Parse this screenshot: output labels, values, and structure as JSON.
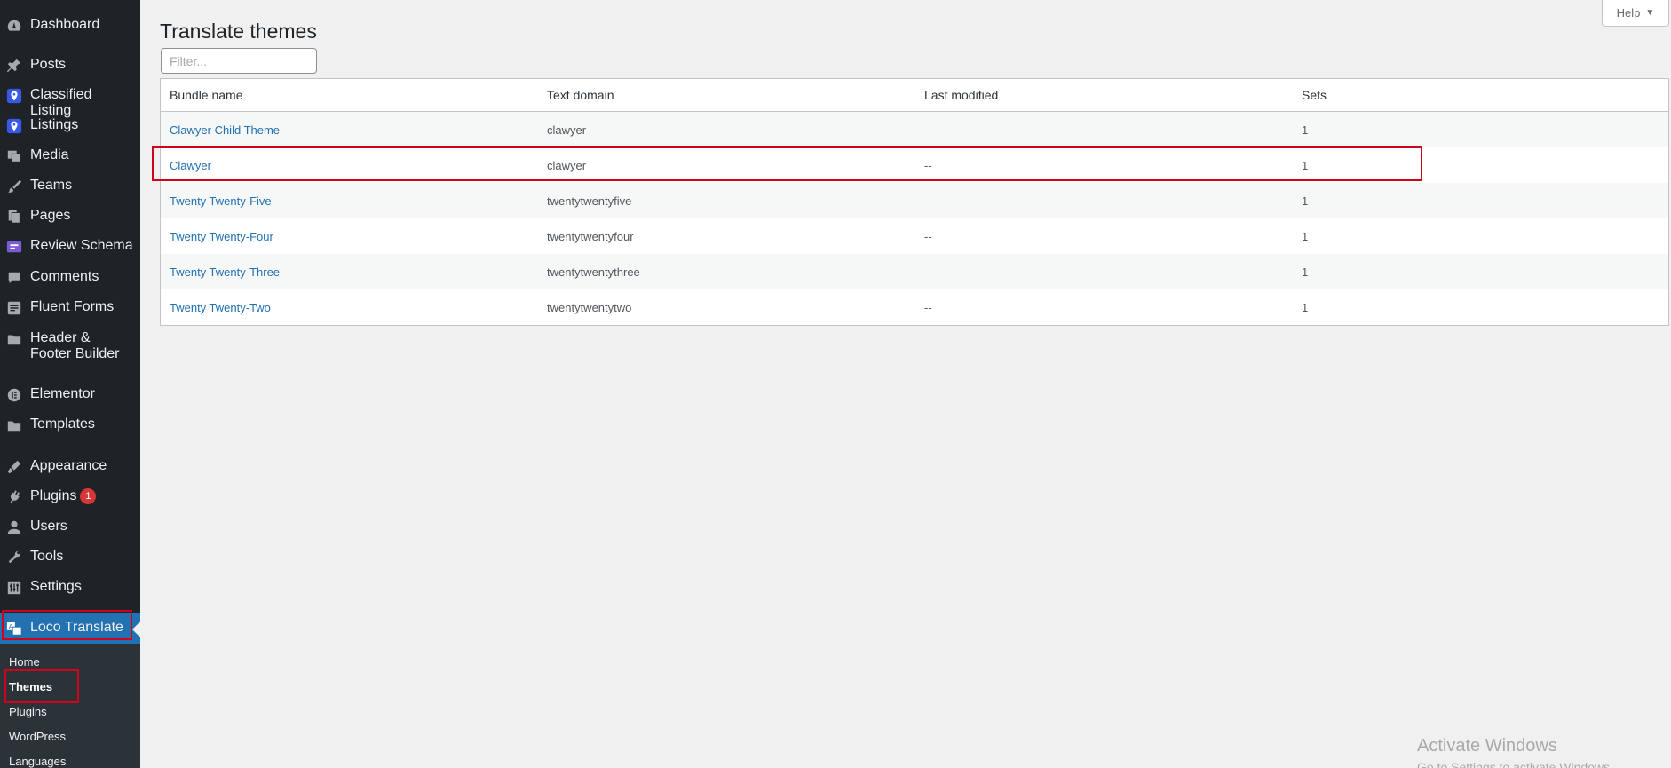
{
  "sidebar": {
    "items": [
      {
        "label": "Dashboard",
        "icon": "dashboard-icon"
      },
      {
        "label": "Posts",
        "icon": "pin-icon"
      },
      {
        "label": "Classified Listing",
        "icon": "location-icon"
      },
      {
        "label": "Listings",
        "icon": "location-icon"
      },
      {
        "label": "Media",
        "icon": "media-icon"
      },
      {
        "label": "Teams",
        "icon": "brush-icon"
      },
      {
        "label": "Pages",
        "icon": "pages-icon"
      },
      {
        "label": "Review Schema",
        "icon": "review-icon"
      },
      {
        "label": "Comments",
        "icon": "comment-icon"
      },
      {
        "label": "Fluent Forms",
        "icon": "form-icon"
      },
      {
        "label": "Header & Footer Builder",
        "icon": "folder-icon"
      },
      {
        "label": "Elementor",
        "icon": "elementor-icon"
      },
      {
        "label": "Templates",
        "icon": "folder-icon"
      },
      {
        "label": "Appearance",
        "icon": "appearance-icon"
      },
      {
        "label": "Plugins",
        "icon": "plugin-icon",
        "badge": "1"
      },
      {
        "label": "Users",
        "icon": "user-icon"
      },
      {
        "label": "Tools",
        "icon": "wrench-icon"
      },
      {
        "label": "Settings",
        "icon": "settings-icon"
      },
      {
        "label": "Loco Translate",
        "icon": "translate-icon"
      }
    ],
    "submenu": [
      {
        "label": "Home"
      },
      {
        "label": "Themes"
      },
      {
        "label": "Plugins"
      },
      {
        "label": "WordPress"
      },
      {
        "label": "Languages"
      }
    ]
  },
  "page": {
    "title": "Translate themes",
    "help_label": "Help",
    "filter_placeholder": "Filter..."
  },
  "table": {
    "headers": [
      "Bundle name",
      "Text domain",
      "Last modified",
      "Sets"
    ],
    "rows": [
      [
        "Clawyer Child Theme",
        "clawyer",
        "--",
        "1"
      ],
      [
        "Clawyer",
        "clawyer",
        "--",
        "1"
      ],
      [
        "Twenty Twenty-Five",
        "twentytwentyfive",
        "--",
        "1"
      ],
      [
        "Twenty Twenty-Four",
        "twentytwentyfour",
        "--",
        "1"
      ],
      [
        "Twenty Twenty-Three",
        "twentytwentythree",
        "--",
        "1"
      ],
      [
        "Twenty Twenty-Two",
        "twentytwentytwo",
        "--",
        "1"
      ]
    ]
  },
  "watermark": {
    "line1": "Activate Windows",
    "line2": "Go to Settings to activate Windows."
  },
  "colors": {
    "sidebar_bg": "#1d2327",
    "accent": "#2271b1",
    "highlight": "#d0021b",
    "badge": "#d63638"
  }
}
